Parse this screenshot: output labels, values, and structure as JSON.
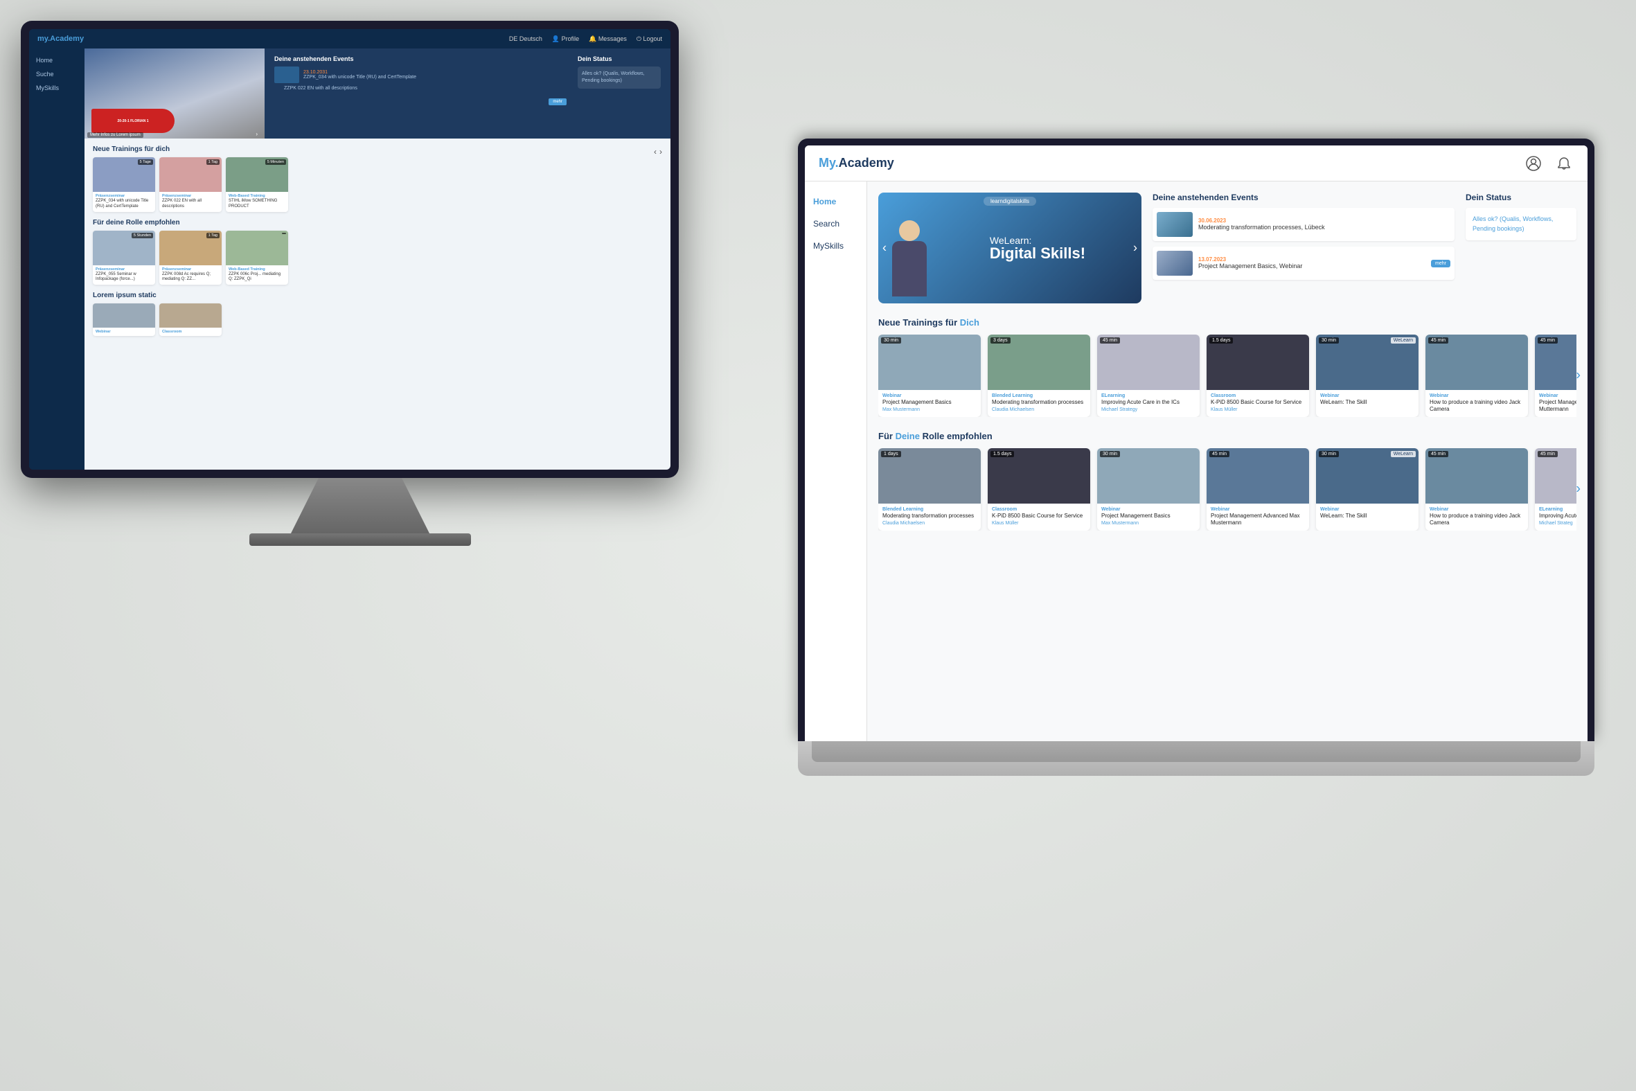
{
  "desktop": {
    "logo": "Academy",
    "logo_prefix": "my.",
    "topbar": {
      "lang": "DE Deutsch",
      "profile": "Profile",
      "messages": "Messages",
      "logout": "Logout"
    },
    "sidebar": {
      "items": [
        "Home",
        "Suche",
        "MySkills"
      ]
    },
    "hero": {
      "events_title": "Deine anstehenden Events",
      "status_title": "Dein Status",
      "status_text": "Alles ok?\n(Qualis, Workflows, Pending bookings)",
      "events": [
        {
          "date": "23.10.2031",
          "name": "ZZPK_034 with unicode Title (RU) and CertTemplate"
        },
        {
          "date": "",
          "name": "ZZPK 022 EN with all descriptions"
        }
      ],
      "mehr_button": "mehr"
    },
    "sections": [
      {
        "title": "Neue Trainings für dich",
        "cards": [
          {
            "badge": "5 Tage",
            "type": "Präsenzseminar",
            "title": "ZZPK_034 with unicode Title (RU) and CertTemplate",
            "bg": "#8B9DC3"
          },
          {
            "badge": "1 Tag",
            "type": "Präsenzseminar",
            "title": "ZZPK 022 EN with all descriptions",
            "bg": "#D4A0A0"
          },
          {
            "badge": "5 Minuten",
            "type": "Web-Based Training",
            "title": "STIHL iMow SOMETHING PRODUCT",
            "bg": "#7B9E87"
          }
        ]
      },
      {
        "title": "Für deine Rolle empfohlen",
        "cards": [
          {
            "badge": "5 Stunden",
            "type": "Präsenzseminar",
            "title": "ZZPK_055 Seminar w Infopackage (force...)",
            "bg": "#A0B4C8"
          },
          {
            "badge": "1 Tag",
            "type": "Präsenzseminar",
            "title": "ZZPK 008d Ac requires Q; mediating Q: ZZ...",
            "bg": "#C8A87A"
          },
          {
            "badge": "",
            "type": "Web-Based Training",
            "title": "ZZPK 006c Proj... mediating Q: ZZPK_Qi",
            "bg": "#9CB897"
          }
        ]
      },
      {
        "title": "Lorem ipsum static",
        "cards": []
      }
    ]
  },
  "laptop": {
    "logo_prefix": "My.",
    "logo": "Academy",
    "sidebar": {
      "items": [
        "Home",
        "Search",
        "MySkills"
      ]
    },
    "hero": {
      "banner_tag": "learndigitalskills",
      "banner_line1": "WeLearn:",
      "banner_line2": "Digital Skills!",
      "events_title": "Deine anstehenden Events",
      "status_title": "Dein Status",
      "status_text": "Alles ok?\n(Qualis, Workflows, Pending bookings)",
      "events": [
        {
          "date": "30.06.2023",
          "name": "Moderating transformation processes, Lübeck"
        },
        {
          "date": "13.07.2023",
          "name": "Project Management Basics, Webinar",
          "has_button": true,
          "button_label": "mehr"
        }
      ]
    },
    "sections": [
      {
        "title": "Neue Trainings für Dich",
        "highlight_word": "Dich",
        "cards": [
          {
            "badge_left": "30 min",
            "type": "Webinar",
            "title": "Project Management Basics",
            "author": "Max Mustermann",
            "bg": "#8fa8b8"
          },
          {
            "badge_left": "3 days",
            "type": "Blended Learning",
            "title": "Moderating transformation processes",
            "author": "Claudia Michaelsen",
            "bg": "#7a9e8a"
          },
          {
            "badge_left": "45 min",
            "type": "eLearning",
            "title": "Improving Acute Care in the ICs",
            "author": "Michael Strategy",
            "bg": "#b8b8c8"
          },
          {
            "badge_left": "1.5 days",
            "type": "Classroom",
            "title": "K-PiD 8500 Basic Course for Service",
            "author": "Klaus Müller",
            "bg": "#3a3a4a"
          },
          {
            "badge_left": "30 min",
            "type": "Webinar",
            "title": "WeLearn: The Skill",
            "author": "",
            "bg": "#4a6a8a"
          },
          {
            "badge_left": "45 min",
            "type": "Webinar",
            "title": "How to produce a training video Jack Camera",
            "author": "",
            "bg": "#6a8aa0"
          },
          {
            "badge_left": "45 min",
            "type": "Webinar",
            "title": "Project Management Advanced Max Muttermann",
            "author": "",
            "bg": "#5a7898"
          }
        ]
      },
      {
        "title": "Für Deine Rolle empfohlen",
        "highlight_word": "Deine",
        "cards": [
          {
            "badge_left": "1 days",
            "type": "Blended Learning",
            "title": "Moderating transformation processes",
            "author": "Claudia Michaelsen",
            "bg": "#7a8a9a"
          },
          {
            "badge_left": "1.5 days",
            "type": "Classroom",
            "title": "K-PiD 8500 Basic Course for Service",
            "author": "Klaus Müller",
            "bg": "#3a3a4a"
          },
          {
            "badge_left": "30 min",
            "type": "Webinar",
            "title": "Project Management Basics",
            "author": "Max Mustermann",
            "bg": "#8fa8b8"
          },
          {
            "badge_left": "45 min",
            "type": "Webinar",
            "title": "Project Management Advanced Max Mustermann",
            "author": "",
            "bg": "#5a7898"
          },
          {
            "badge_left": "30 min",
            "type": "Webinar",
            "title": "WeLearn: The Skill",
            "author": "",
            "bg": "#4a6a8a"
          },
          {
            "badge_left": "45 min",
            "type": "Webinar",
            "title": "How to produce a training video Jack Camera",
            "author": "",
            "bg": "#6a8aa0"
          },
          {
            "badge_left": "45 min",
            "type": "eLearning",
            "title": "Improving Acute Care in the ICs",
            "author": "Michael Strateg",
            "bg": "#b8b8c8"
          }
        ]
      }
    ]
  }
}
